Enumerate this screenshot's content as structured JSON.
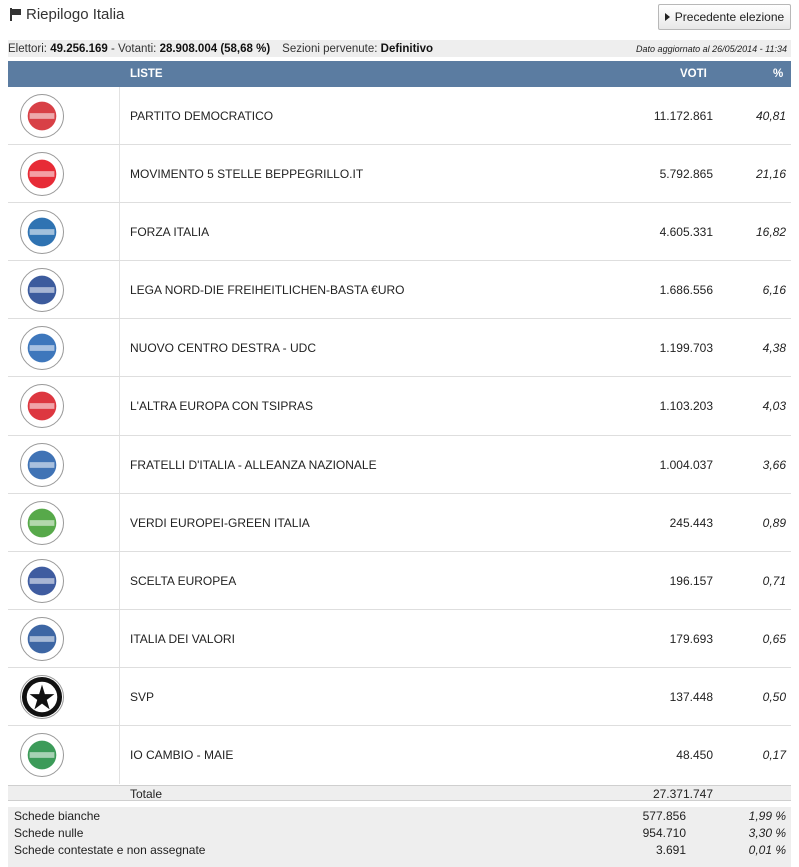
{
  "header": {
    "title": "Riepilogo Italia",
    "prev_button": "Precedente elezione"
  },
  "info": {
    "elettori_label": "Elettori:",
    "elettori": "49.256.169",
    "votanti_label": "- Votanti:",
    "votanti": "28.908.004 (58,68 %)",
    "sezioni_label": "Sezioni pervenute:",
    "sezioni": "Definitivo",
    "updated": "Dato aggiornato al 26/05/2014 - 11:34"
  },
  "table": {
    "col_liste": "LISTE",
    "col_voti": "VOTI",
    "col_pct": "%",
    "rows": [
      {
        "name": "PARTITO DEMOCRATICO",
        "votes": "11.172.861",
        "pct": "40,81",
        "logo_color": "#d11f26"
      },
      {
        "name": "MOVIMENTO 5 STELLE BEPPEGRILLO.IT",
        "votes": "5.792.865",
        "pct": "21,16",
        "logo_color": "#e30613"
      },
      {
        "name": "FORZA ITALIA",
        "votes": "4.605.331",
        "pct": "16,82",
        "logo_color": "#0a5aa5"
      },
      {
        "name": "LEGA NORD-DIE FREIHEITLICHEN-BASTA €URO",
        "votes": "1.686.556",
        "pct": "6,16",
        "logo_color": "#1a3e8c"
      },
      {
        "name": "NUOVO CENTRO DESTRA - UDC",
        "votes": "1.199.703",
        "pct": "4,38",
        "logo_color": "#1c5fb0"
      },
      {
        "name": "L'ALTRA EUROPA CON TSIPRAS",
        "votes": "1.103.203",
        "pct": "4,03",
        "logo_color": "#d7141e"
      },
      {
        "name": "FRATELLI D'ITALIA - ALLEANZA NAZIONALE",
        "votes": "1.004.037",
        "pct": "3,66",
        "logo_color": "#1e5aa8"
      },
      {
        "name": "VERDI EUROPEI-GREEN ITALIA",
        "votes": "245.443",
        "pct": "0,89",
        "logo_color": "#3a9a2a"
      },
      {
        "name": "SCELTA EUROPEA",
        "votes": "196.157",
        "pct": "0,71",
        "logo_color": "#1d3f8f"
      },
      {
        "name": "ITALIA DEI VALORI",
        "votes": "179.693",
        "pct": "0,65",
        "logo_color": "#1b4b94"
      },
      {
        "name": "SVP",
        "votes": "137.448",
        "pct": "0,50",
        "logo_color": "#111111"
      },
      {
        "name": "IO CAMBIO - MAIE",
        "votes": "48.450",
        "pct": "0,17",
        "logo_color": "#1a8a3c"
      }
    ],
    "total_label": "Totale",
    "total_votes": "27.371.747"
  },
  "extras": [
    {
      "label": "Schede bianche",
      "value": "577.856",
      "pct": "1,99 %"
    },
    {
      "label": "Schede nulle",
      "value": "954.710",
      "pct": "3,30 %"
    },
    {
      "label": "Schede contestate e non assegnate",
      "value": "3.691",
      "pct": "0,01 %"
    }
  ]
}
